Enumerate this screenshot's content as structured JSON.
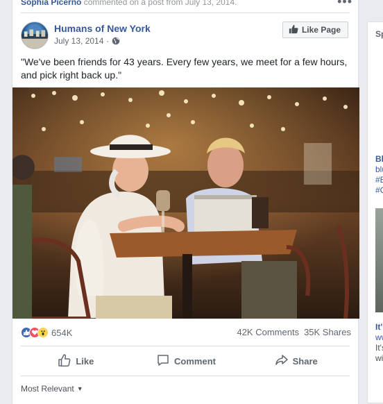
{
  "activity": {
    "actor": "Sophia Picerno",
    "text": "commented on a post from July 13, 2014."
  },
  "post": {
    "page_name": "Humans of New York",
    "date": "July 13, 2014",
    "separator": "·",
    "like_page_label": "Like Page",
    "caption": "\"We've been friends for 43 years. Every few years, we meet for a few hours, and pick right back up.\"",
    "reaction_count": "654K",
    "comments": "42K Comments",
    "shares": "35K Shares",
    "reactions": [
      "like-icon",
      "love-icon",
      "wow-icon"
    ],
    "actions": {
      "like": "Like",
      "comment": "Comment",
      "share": "Share"
    },
    "sort_label": "Most Relevant"
  },
  "right_panel": {
    "title": "Sp",
    "ad1": {
      "line1": "Bl",
      "line2": "blu",
      "line3": "#E",
      "line4": "#C"
    },
    "ad2": {
      "title": "It'",
      "link": "ww",
      "line1": "It's",
      "line2": "wi"
    }
  },
  "colors": {
    "link": "#365899",
    "like_blue": "#4267b2",
    "love_red": "#f25268",
    "wow_yellow": "#fbd44e"
  }
}
